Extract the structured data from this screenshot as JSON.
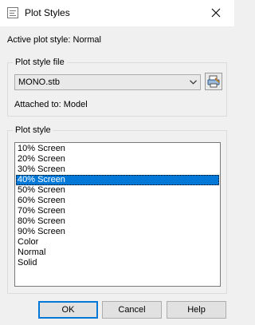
{
  "window": {
    "title": "Plot Styles",
    "icon": "plot-styles-app-icon",
    "close_icon": "close-icon"
  },
  "active_plot_style": "Active plot style: Normal",
  "plot_style_file": {
    "group_label": "Plot style file",
    "selected_file": "MONO.stb",
    "dropdown_icon": "chevron-down-icon",
    "edit_button_icon": "plot-style-editor-icon",
    "attached_to": "Attached to: Model"
  },
  "plot_style": {
    "group_label": "Plot style",
    "items": [
      {
        "label": "10% Screen"
      },
      {
        "label": "20% Screen"
      },
      {
        "label": "30% Screen"
      },
      {
        "label": "40% Screen",
        "selected": true
      },
      {
        "label": "50% Screen"
      },
      {
        "label": "60% Screen"
      },
      {
        "label": "70% Screen"
      },
      {
        "label": "80% Screen"
      },
      {
        "label": "90% Screen"
      },
      {
        "label": "Color"
      },
      {
        "label": "Normal"
      },
      {
        "label": "Solid"
      }
    ]
  },
  "buttons": {
    "ok": "OK",
    "cancel": "Cancel",
    "help": "Help"
  },
  "colors": {
    "selection": "#0078d7",
    "dialog_bg": "#f0f0f0",
    "titlebar_bg": "#ffffff"
  }
}
